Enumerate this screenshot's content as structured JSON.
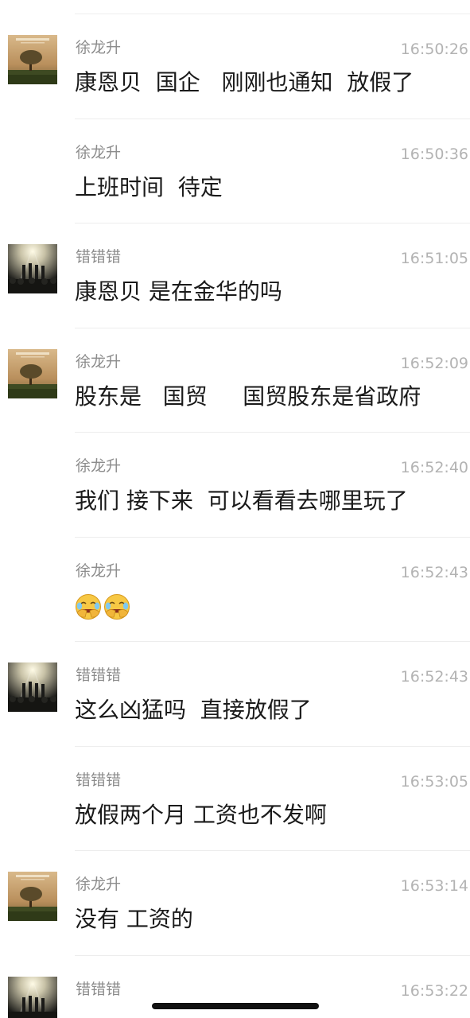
{
  "chat": {
    "messages": [
      {
        "sender": "徐龙升",
        "avatar": "sunset-tree-avatar",
        "time": "16:50:26",
        "text": "康恩贝  国企   刚刚也通知  放假了"
      },
      {
        "sender": "徐龙升",
        "avatar": "",
        "time": "16:50:36",
        "text": "上班时间  待定"
      },
      {
        "sender": "错错错",
        "avatar": "concert-crowd-avatar",
        "time": "16:51:05",
        "text": "康恩贝 是在金华的吗"
      },
      {
        "sender": "徐龙升",
        "avatar": "sunset-tree-avatar",
        "time": "16:52:09",
        "text": "股东是   国贸     国贸股东是省政府"
      },
      {
        "sender": "徐龙升",
        "avatar": "",
        "time": "16:52:40",
        "text": "我们 接下来  可以看看去哪里玩了"
      },
      {
        "sender": "徐龙升",
        "avatar": "",
        "time": "16:52:43",
        "text": "",
        "emoji": [
          "facepalm-laugh-emoji",
          "facepalm-laugh-emoji"
        ]
      },
      {
        "sender": "错错错",
        "avatar": "concert-crowd-avatar",
        "time": "16:52:43",
        "text": "这么凶猛吗  直接放假了"
      },
      {
        "sender": "错错错",
        "avatar": "",
        "time": "16:53:05",
        "text": "放假两个月 工资也不发啊"
      },
      {
        "sender": "徐龙升",
        "avatar": "sunset-tree-avatar",
        "time": "16:53:14",
        "text": "没有 工资的"
      },
      {
        "sender": "错错错",
        "avatar": "concert-crowd-avatar",
        "time": "16:53:22",
        "text": ""
      }
    ]
  },
  "colors": {
    "name": "#8c8c8c",
    "time": "#b3b3b3",
    "text": "#1a1a1a",
    "divider": "#ededed"
  }
}
